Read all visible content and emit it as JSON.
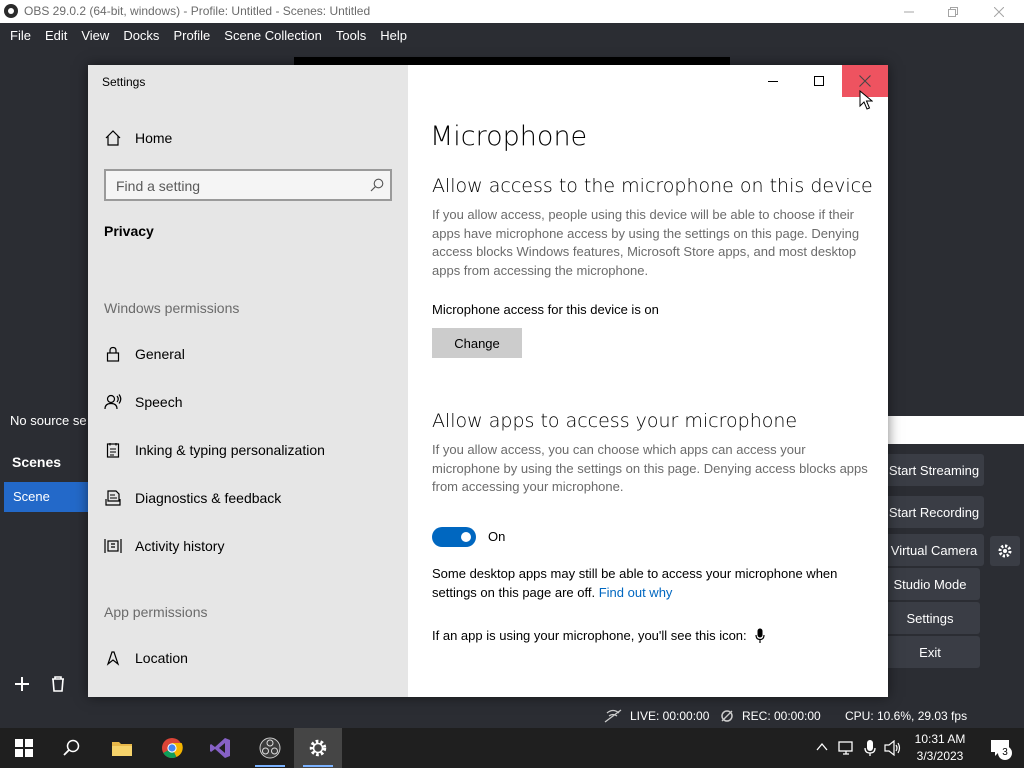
{
  "obs": {
    "title": "OBS 29.0.2 (64-bit, windows) - Profile: Untitled - Scenes: Untitled",
    "menu": [
      "File",
      "Edit",
      "View",
      "Docks",
      "Profile",
      "Scene Collection",
      "Tools",
      "Help"
    ],
    "sources_empty": "No source se",
    "scenes_header": "Scenes",
    "scene_item": "Scene",
    "controls": {
      "start_streaming": "Start Streaming",
      "start_recording": "Start Recording",
      "virtual_camera": "Virtual Camera",
      "studio_mode": "Studio Mode",
      "settings": "Settings",
      "exit": "Exit"
    },
    "status": {
      "live": "LIVE: 00:00:00",
      "rec": "REC: 00:00:00",
      "cpu": "CPU: 10.6%, 29.03 fps"
    }
  },
  "settings_window": {
    "title": "Settings",
    "sidebar": {
      "home": "Home",
      "search_placeholder": "Find a setting",
      "section": "Privacy",
      "group_windows": "Windows permissions",
      "windows_items": [
        {
          "label": "General",
          "icon": "lock-icon"
        },
        {
          "label": "Speech",
          "icon": "speech-icon"
        },
        {
          "label": "Inking & typing personalization",
          "icon": "inking-icon"
        },
        {
          "label": "Diagnostics & feedback",
          "icon": "diagnostics-icon"
        },
        {
          "label": "Activity history",
          "icon": "activity-history-icon"
        }
      ],
      "group_app": "App permissions",
      "app_items": [
        {
          "label": "Location",
          "icon": "location-icon"
        }
      ]
    },
    "content": {
      "page_title": "Microphone",
      "section1_title": "Allow access to the microphone on this device",
      "section1_desc": "If you allow access, people using this device will be able to choose if their apps have microphone access by using the settings on this page. Denying access blocks Windows features, Microsoft Store apps, and most desktop apps from accessing the microphone.",
      "device_status": "Microphone access for this device is on",
      "change_button": "Change",
      "section2_title": "Allow apps to access your microphone",
      "section2_desc": "If you allow access, you can choose which apps can access your microphone by using the settings on this page. Denying access blocks apps from accessing your microphone.",
      "toggle_label": "On",
      "toggle_on": true,
      "desktop_note": "Some desktop apps may still be able to access your microphone when settings on this page are off.",
      "find_out_why": "Find out why",
      "icon_note": "If an app is using your microphone, you'll see this icon:"
    }
  },
  "taskbar": {
    "clock_time": "10:31 AM",
    "clock_date": "3/3/2023",
    "notification_count": "3"
  },
  "colors": {
    "accent": "#0067c0",
    "obs_bg": "#2b2d33",
    "scene_selected": "#2369c9",
    "close_hover": "#e81123"
  }
}
